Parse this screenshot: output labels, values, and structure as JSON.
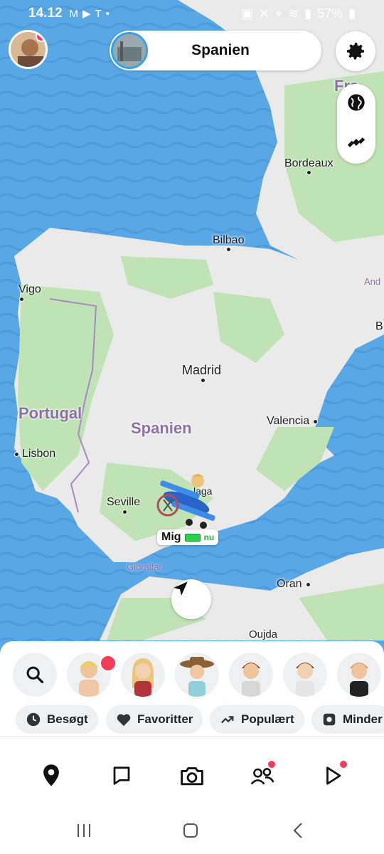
{
  "status_bar": {
    "time": "14.12",
    "left_icons": [
      "gmail-icon",
      "youtube-icon",
      "tesla-icon"
    ],
    "battery": "57%"
  },
  "header": {
    "location_title": "Spanien"
  },
  "map": {
    "cities": [
      {
        "name": "Bordeaux"
      },
      {
        "name": "Bilbao"
      },
      {
        "name": "Vigo"
      },
      {
        "name": "Madrid"
      },
      {
        "name": "Valencia"
      },
      {
        "name": "Lisbon"
      },
      {
        "name": "Seville"
      },
      {
        "name": "Oran"
      },
      {
        "name": "Oujda"
      }
    ],
    "countries": {
      "portugal": "Portugal",
      "spain": "Spanien",
      "france_partial": "Fra"
    },
    "small_labels": {
      "gibraltar": "Gibraltar",
      "andorra_partial": "And",
      "b_partial": "B",
      "malaga_partial": "laga"
    },
    "user_marker": {
      "name": "Mig",
      "time": "nu"
    }
  },
  "filters": [
    {
      "label": "Besøgt",
      "icon": "clock-icon"
    },
    {
      "label": "Favoritter",
      "icon": "heart-icon"
    },
    {
      "label": "Populært",
      "icon": "trending-icon"
    },
    {
      "label": "Minder",
      "icon": "memories-icon"
    }
  ],
  "nav": [
    "map-pin-icon",
    "chat-icon",
    "camera-icon",
    "friends-icon",
    "stories-icon"
  ],
  "colors": {
    "water": "#5aa7e6",
    "land": "#eaeaea",
    "green": "#bfe3b4",
    "accent_red": "#f23c57"
  }
}
